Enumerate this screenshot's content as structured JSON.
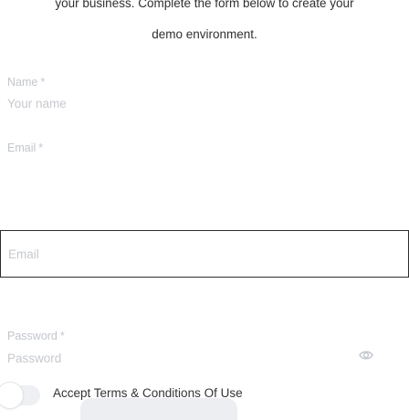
{
  "intro": {
    "line1": "your business. Complete the form below to create your",
    "line2": "demo environment."
  },
  "form": {
    "name": {
      "label": "Name",
      "required_mark": "*",
      "placeholder": "Your name"
    },
    "email": {
      "label": "Email",
      "required_mark": "*",
      "placeholder": "Email"
    },
    "password": {
      "label": "Password",
      "required_mark": "*",
      "placeholder": "Password",
      "toggle_icon": "eye-icon"
    },
    "terms": {
      "label": "Accept Terms & Conditions Of Use",
      "checked": false
    }
  },
  "colors": {
    "label": "#c2c6cc",
    "placeholder": "#c6c9ce",
    "focus_border": "#2d2d2d",
    "toggle_track": "#eef0f3"
  }
}
